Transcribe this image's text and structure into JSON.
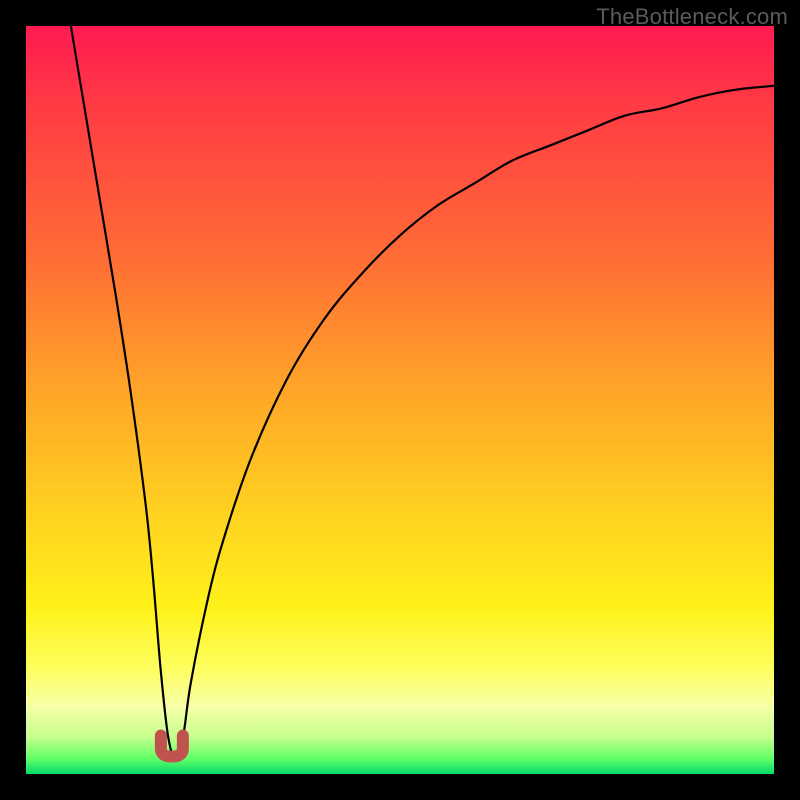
{
  "watermark": "TheBottleneck.com",
  "chart_data": {
    "type": "line",
    "title": "",
    "xlabel": "",
    "ylabel": "",
    "xlim": [
      0,
      100
    ],
    "ylim": [
      0,
      100
    ],
    "series": [
      {
        "name": "curve",
        "x": [
          6,
          8,
          10,
          12,
          14,
          16,
          17,
          18,
          19,
          20,
          21,
          22,
          24,
          26,
          30,
          35,
          40,
          45,
          50,
          55,
          60,
          65,
          70,
          75,
          80,
          85,
          90,
          95,
          100
        ],
        "values": [
          100,
          88,
          76,
          64,
          51,
          36,
          26,
          14,
          5,
          2,
          5,
          12,
          22,
          30,
          42,
          53,
          61,
          67,
          72,
          76,
          79,
          82,
          84,
          86,
          88,
          89,
          90.5,
          91.5,
          92
        ]
      }
    ],
    "marker": {
      "x": 19.5,
      "y": 3,
      "color": "#c1534e"
    },
    "gradient_stops": [
      {
        "pct": 0,
        "color": "#ff1a52"
      },
      {
        "pct": 30,
        "color": "#ff6a36"
      },
      {
        "pct": 68,
        "color": "#ffd91f"
      },
      {
        "pct": 95,
        "color": "#c8ff8e"
      },
      {
        "pct": 100,
        "color": "#05d96b"
      }
    ]
  }
}
